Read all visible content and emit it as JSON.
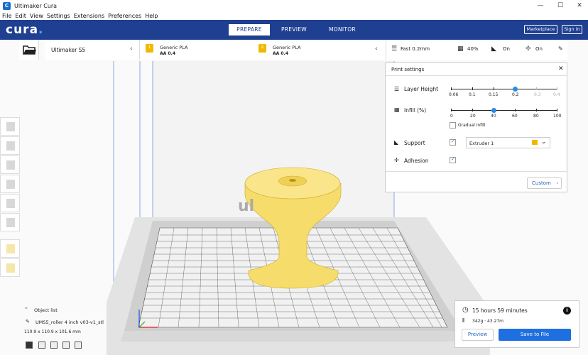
{
  "window": {
    "title": "Ultimaker Cura",
    "app_icon": "cura-app-icon",
    "minimize": "—",
    "maximize": "☐",
    "close": "✕"
  },
  "menu": [
    "File",
    "Edit",
    "View",
    "Settings",
    "Extensions",
    "Preferences",
    "Help"
  ],
  "header": {
    "logo": "cura",
    "tabs": [
      "PREPARE",
      "PREVIEW",
      "MONITOR"
    ],
    "active_tab": "PREPARE",
    "marketplace": "Marketplace",
    "signin": "Sign in"
  },
  "printer": {
    "name": "Ultimaker S5"
  },
  "extruders": [
    {
      "number": "1",
      "material": "Generic PLA",
      "nozzle": "AA 0.4"
    },
    {
      "number": "2",
      "material": "Generic PLA",
      "nozzle": "AA 0.4"
    }
  ],
  "settings_bar": {
    "profile": "Fast 0.2mm",
    "infill": "40%",
    "support": "On",
    "adhesion": "On"
  },
  "print_settings": {
    "title": "Print settings",
    "close": "✕",
    "layer_height": {
      "label": "Layer Height",
      "ticks": [
        "0.06",
        "0.1",
        "0.15",
        "0.2",
        "0.3",
        "0.4"
      ],
      "selected": "0.2"
    },
    "infill": {
      "label": "Infill (%)",
      "ticks": [
        "0",
        "20",
        "40",
        "60",
        "80",
        "100"
      ],
      "value": 40,
      "gradual_label": "Gradual infill",
      "gradual_checked": false
    },
    "support": {
      "label": "Support",
      "checked": true,
      "extruder": "Extruder 1"
    },
    "adhesion": {
      "label": "Adhesion",
      "checked": true
    },
    "custom_button": "Custom"
  },
  "object_list": {
    "title": "Object list",
    "file": "UMS5_roller 4 inch v03-v1_stl",
    "dimensions": "110.9 x 110.9 x 101.6 mm"
  },
  "print_info": {
    "time": "15 hours 59 minutes",
    "material": "342g · 43.27m",
    "preview_button": "Preview",
    "save_button": "Save to File"
  },
  "build_plate_logo": "ul",
  "colors": {
    "header": "#1f3f91",
    "accent": "#1e6fe0",
    "model": "#f6dc6a",
    "extruder_badge": "#f2b800"
  }
}
